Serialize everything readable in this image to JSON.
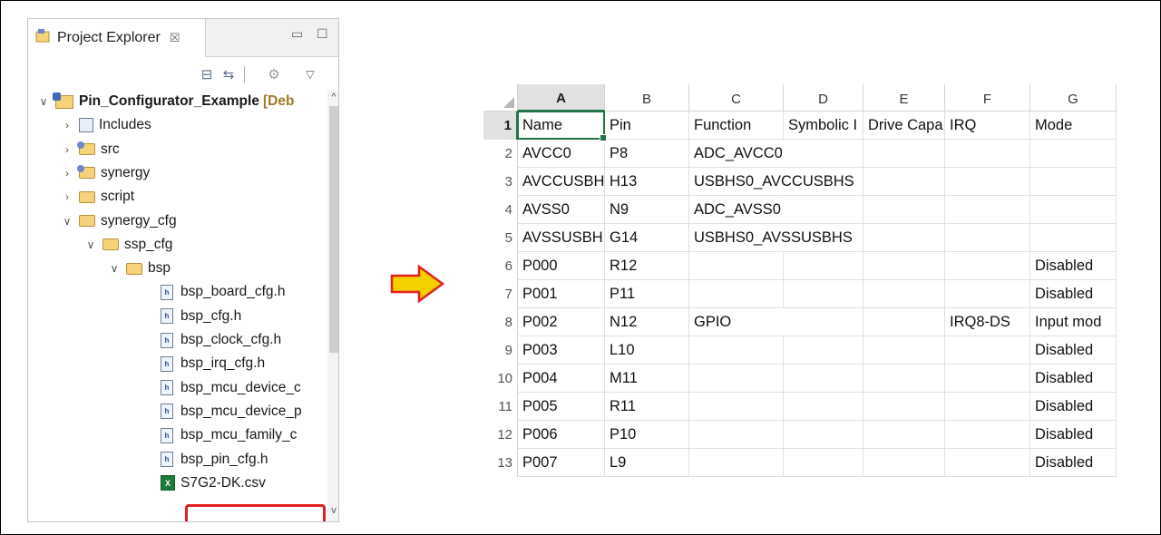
{
  "explorer": {
    "tab_label": "Project Explorer",
    "tab_close": "☒",
    "minimize": "▭",
    "maximize": "☐",
    "toolbar": {
      "collapse_all": "⊟",
      "link_editor": "⇆",
      "filter": "⚙",
      "view_menu": "▽"
    },
    "tree": [
      {
        "label": "Pin_Configurator_Example",
        "suffix": "[Deb",
        "level": 0,
        "twisty": "∨",
        "icon": "project-icon",
        "bold": true
      },
      {
        "label": "Includes",
        "level": 1,
        "twisty": "›",
        "icon": "includes-icon"
      },
      {
        "label": "src",
        "level": 1,
        "twisty": "›",
        "icon": "source-folder-icon"
      },
      {
        "label": "synergy",
        "level": 1,
        "twisty": "›",
        "icon": "source-folder-icon"
      },
      {
        "label": "script",
        "level": 1,
        "twisty": "›",
        "icon": "folder-icon"
      },
      {
        "label": "synergy_cfg",
        "level": 1,
        "twisty": "∨",
        "icon": "folder-icon"
      },
      {
        "label": "ssp_cfg",
        "level": 2,
        "twisty": "∨",
        "icon": "folder-icon"
      },
      {
        "label": "bsp",
        "level": 3,
        "twisty": "∨",
        "icon": "folder-icon"
      },
      {
        "label": "bsp_board_cfg.h",
        "level": 4,
        "icon": "header-file-icon"
      },
      {
        "label": "bsp_cfg.h",
        "level": 4,
        "icon": "header-file-icon"
      },
      {
        "label": "bsp_clock_cfg.h",
        "level": 4,
        "icon": "header-file-icon"
      },
      {
        "label": "bsp_irq_cfg.h",
        "level": 4,
        "icon": "header-file-icon"
      },
      {
        "label": "bsp_mcu_device_c",
        "level": 4,
        "icon": "header-file-icon"
      },
      {
        "label": "bsp_mcu_device_p",
        "level": 4,
        "icon": "header-file-icon"
      },
      {
        "label": "bsp_mcu_family_c",
        "level": 4,
        "icon": "header-file-icon"
      },
      {
        "label": "bsp_pin_cfg.h",
        "level": 4,
        "icon": "header-file-icon"
      },
      {
        "label": "S7G2-DK.csv",
        "level": 4,
        "icon": "csv-file-icon",
        "highlighted": true
      }
    ]
  },
  "arrow_color": "#f5d000",
  "highlight_color": "#e02020",
  "sheet": {
    "columns": [
      "A",
      "B",
      "C",
      "D",
      "E",
      "F",
      "G"
    ],
    "active_column": "A",
    "active_row": "1",
    "rows": [
      {
        "num": "1",
        "cells": [
          "Name",
          "Pin",
          "Function",
          "Symbolic I",
          "Drive Capa",
          "IRQ",
          "Mode"
        ]
      },
      {
        "num": "2",
        "cells": [
          "AVCC0",
          "P8",
          "ADC_AVCC0",
          "",
          "",
          "",
          ""
        ]
      },
      {
        "num": "3",
        "cells": [
          "AVCCUSBH",
          "H13",
          "USBHS0_AVCCUSBHS",
          "",
          "",
          "",
          ""
        ]
      },
      {
        "num": "4",
        "cells": [
          "AVSS0",
          "N9",
          "ADC_AVSS0",
          "",
          "",
          "",
          ""
        ]
      },
      {
        "num": "5",
        "cells": [
          "AVSSUSBH",
          "G14",
          "USBHS0_AVSSUSBHS",
          "",
          "",
          "",
          ""
        ]
      },
      {
        "num": "6",
        "cells": [
          "P000",
          "R12",
          "",
          "",
          "",
          "",
          "Disabled"
        ]
      },
      {
        "num": "7",
        "cells": [
          "P001",
          "P11",
          "",
          "",
          "",
          "",
          "Disabled"
        ]
      },
      {
        "num": "8",
        "cells": [
          "P002",
          "N12",
          "GPIO",
          "",
          "",
          "IRQ8-DS",
          "Input mod"
        ]
      },
      {
        "num": "9",
        "cells": [
          "P003",
          "L10",
          "",
          "",
          "",
          "",
          "Disabled"
        ]
      },
      {
        "num": "10",
        "cells": [
          "P004",
          "M11",
          "",
          "",
          "",
          "",
          "Disabled"
        ]
      },
      {
        "num": "11",
        "cells": [
          "P005",
          "R11",
          "",
          "",
          "",
          "",
          "Disabled"
        ]
      },
      {
        "num": "12",
        "cells": [
          "P006",
          "P10",
          "",
          "",
          "",
          "",
          "Disabled"
        ]
      },
      {
        "num": "13",
        "cells": [
          "P007",
          "L9",
          "",
          "",
          "",
          "",
          "Disabled"
        ]
      }
    ]
  }
}
